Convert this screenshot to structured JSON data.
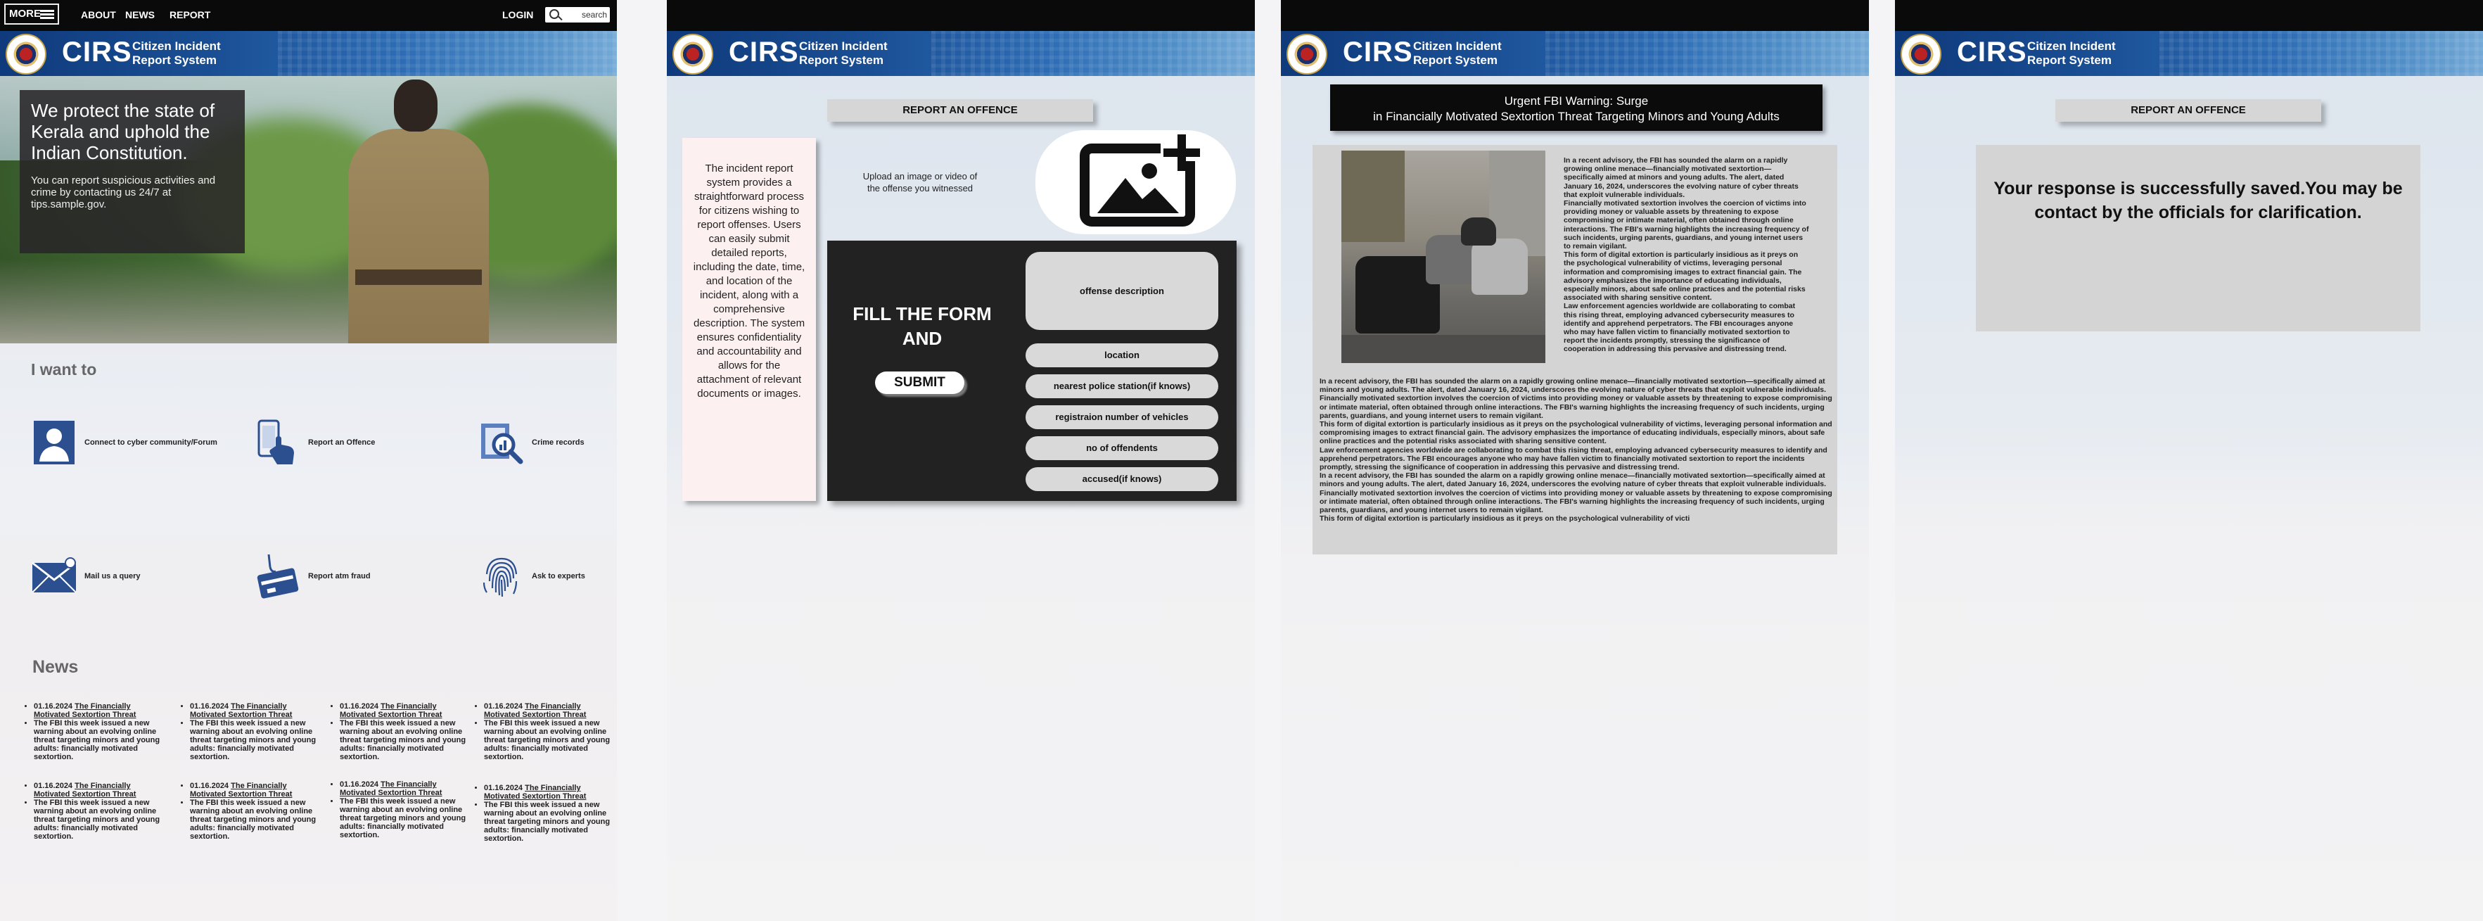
{
  "site": {
    "brand": "CIRS",
    "brand_sub": "Citizen Incident Report System"
  },
  "screen1": {
    "nav": {
      "more": "MORE",
      "about": "ABOUT",
      "news": "NEWS",
      "report": "REPORT",
      "login": "LOGIN",
      "search_placeholder": "search"
    },
    "hero": {
      "headline": "We protect the  state of Kerala and uphold the  Indian  Constitution.",
      "body": "You can report suspicious activities and crime by contacting us 24/7 at tips.sample.gov."
    },
    "i_want_to": "I want to",
    "actions": [
      {
        "label": "Connect to cyber community/Forum",
        "icon": "person-icon"
      },
      {
        "label": "Report an Offence",
        "icon": "touch-phone-icon"
      },
      {
        "label": "Crime records",
        "icon": "records-search-icon"
      },
      {
        "label": "Mail us a query",
        "icon": "mail-icon"
      },
      {
        "label": "Report atm fraud",
        "icon": "atm-card-icon"
      },
      {
        "label": "Ask to experts",
        "icon": "fingerprint-icon"
      }
    ],
    "news_heading": "News",
    "news": [
      {
        "date": "01.16.2024",
        "title": "The Financially Motivated Sextortion Threat",
        "body": "The FBI this week issued a new warning about an evolving online threat targeting minors and young adults: financially motivated sextortion."
      },
      {
        "date": "01.16.2024",
        "title": "The Financially Motivated Sextortion Threat",
        "body": "The FBI this week issued a new warning about an evolving online threat targeting minors and young adults: financially motivated sextortion."
      },
      {
        "date": "01.16.2024",
        "title": "The Financially Motivated Sextortion Threat",
        "body": "The FBI this week issued a new warning about an evolving online threat targeting minors and young adults: financially motivated sextortion."
      },
      {
        "date": "01.16.2024",
        "title": "The Financially Motivated Sextortion Threat",
        "body": "The FBI this week issued a new warning about an evolving online threat targeting minors and young adults: financially motivated sextortion."
      },
      {
        "date": "01.16.2024",
        "title": "The Financially Motivated Sextortion Threat",
        "body": "The FBI this week issued a new warning about an evolving online threat targeting minors and young adults: financially motivated sextortion."
      },
      {
        "date": "01.16.2024",
        "title": "The Financially Motivated Sextortion Threat",
        "body": "The FBI this week issued a new warning about an evolving online threat targeting minors and young adults: financially motivated sextortion."
      },
      {
        "date": "01.16.2024",
        "title": "The Financially Motivated Sextortion Threat",
        "body": "The FBI this week issued a new warning about an evolving online threat targeting minors and young adults: financially motivated sextortion."
      },
      {
        "date": "01.16.2024",
        "title": "The Financially Motivated Sextortion Threat",
        "body": "The FBI this week issued a new warning about an evolving online threat targeting minors and young adults: financially motivated sextortion."
      }
    ]
  },
  "screen2": {
    "header_button": "REPORT AN OFFENCE",
    "description": "The incident report system provides a straightforward process for citizens wishing to report offenses. Users can easily submit detailed reports, including the date, time, and location of the incident, along with a comprehensive description. The system ensures confidentiality and accountability and allows for the attachment of relevant documents or images.",
    "upload_text": "Upload an image or video of the offense you witnessed",
    "form_title": "FILL THE FORM AND",
    "submit": "SUBMIT",
    "fields": {
      "offense_description": "offense description",
      "location": "location",
      "nearest_police_station": "nearest police station(if knows)",
      "vehicle_reg": "registraion number of vehicles",
      "offendents": "no of offendents",
      "accused": "accused(if knows)"
    }
  },
  "screen3": {
    "alert_line1": "Urgent FBI Warning: Surge",
    "alert_line2": "in Financially Motivated Sextortion Threat Targeting Minors and Young Adults",
    "article_side": "In a recent advisory, the FBI has sounded the alarm on a rapidly growing online menace—financially motivated sextortion—specifically aimed at minors and young adults. The alert, dated January 16, 2024, underscores the evolving nature of cyber threats that exploit vulnerable individuals.\nFinancially motivated sextortion involves the coercion of victims into providing money or valuable assets by threatening to expose compromising or intimate material, often obtained through online interactions. The FBI's warning highlights the increasing frequency of such incidents, urging parents, guardians, and young internet users to remain vigilant.\nThis form of digital extortion is particularly insidious as it preys on the psychological vulnerability of victims, leveraging personal information and compromising images to extract financial gain. The advisory emphasizes the importance of educating individuals, especially minors, about safe online practices and the potential risks associated with sharing sensitive content.\nLaw enforcement agencies worldwide are collaborating to combat this rising threat, employing advanced cybersecurity measures to identify and apprehend perpetrators. The FBI encourages anyone who may have fallen victim to financially motivated sextortion to report the incidents promptly, stressing the significance of cooperation in addressing this pervasive and distressing trend.",
    "article_full": "In a recent advisory, the FBI has sounded the alarm on a rapidly growing online menace—financially motivated sextortion—specifically aimed at minors and young adults. The alert, dated January 16, 2024, underscores the evolving nature of cyber threats that exploit vulnerable individuals.\nFinancially motivated sextortion involves the coercion of victims into providing money or valuable assets by threatening to expose compromising or intimate material, often obtained through online interactions. The FBI's warning highlights the increasing frequency of such incidents, urging parents, guardians, and young internet users to remain vigilant.\nThis form of digital extortion is particularly insidious as it preys on the psychological vulnerability of victims, leveraging personal information and compromising images to extract financial gain. The advisory emphasizes the importance of educating individuals, especially minors, about safe online practices and the potential risks associated with sharing sensitive content.\nLaw enforcement agencies worldwide are collaborating to combat this rising threat, employing advanced cybersecurity measures to identify and apprehend perpetrators. The FBI encourages anyone who may have fallen victim to financially motivated sextortion to report the incidents promptly, stressing the significance of cooperation in addressing this pervasive and distressing trend.\nIn a recent advisory, the FBI has sounded the alarm on a rapidly growing online menace—financially motivated sextortion—specifically aimed at minors and young adults. The alert, dated January 16, 2024, underscores the evolving nature of cyber threats that exploit vulnerable individuals.\nFinancially motivated sextortion involves the coercion of victims into providing money or valuable assets by threatening to expose compromising or intimate material, often obtained through online interactions. The FBI's warning highlights the increasing frequency of such incidents, urging parents, guardians, and young internet users to remain vigilant.\nThis form of digital extortion is particularly insidious as it preys on the psychological vulnerability of victi"
  },
  "screen4": {
    "header_button": "REPORT AN OFFENCE",
    "response": "Your response is successfully saved.You may be contact by the officials for clarification."
  }
}
